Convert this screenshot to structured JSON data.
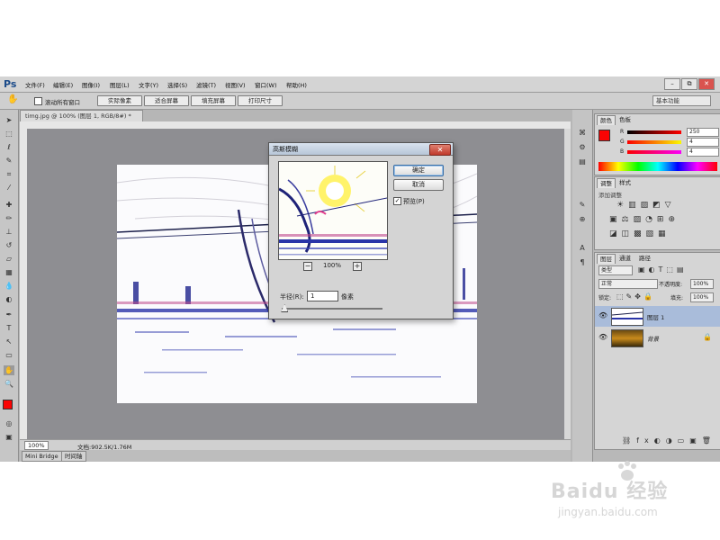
{
  "app": {
    "logo": "Ps",
    "menus": [
      "文件(F)",
      "编辑(E)",
      "图像(I)",
      "图层(L)",
      "文字(Y)",
      "选择(S)",
      "滤镜(T)",
      "视图(V)",
      "窗口(W)",
      "帮助(H)"
    ],
    "window_buttons": [
      "–",
      "⧉",
      "✕"
    ]
  },
  "options_bar": {
    "scroll_all_label": "滚动所有窗口",
    "buttons": [
      "实际像素",
      "适合屏幕",
      "填充屏幕",
      "打印尺寸"
    ],
    "workspace": "基本功能"
  },
  "document": {
    "tab_title": "timg.jpg @ 100% (图层 1, RGB/8#) *",
    "zoom": "100%",
    "doc_info": "文档:902.5K/1.76M"
  },
  "bottom_tabs": [
    "Mini Bridge",
    "时间轴"
  ],
  "color_panel": {
    "tabs": [
      "颜色",
      "色板"
    ],
    "labels": [
      "R",
      "G",
      "B"
    ],
    "values": [
      "250",
      "4",
      "4"
    ],
    "foreground": "#fa0404",
    "background": "#ffffff"
  },
  "adjustments_panel": {
    "tabs": [
      "调整",
      "样式"
    ],
    "hint": "添加调整"
  },
  "layers_panel": {
    "tabs": [
      "图层",
      "通道",
      "路径"
    ],
    "kind_label": "类型",
    "blend_mode": "正常",
    "opacity_label": "不透明度:",
    "opacity_value": "100%",
    "lock_label": "锁定:",
    "fill_label": "填充:",
    "fill_value": "100%",
    "layers": [
      {
        "name": "图层 1",
        "selected": true
      },
      {
        "name": "背景",
        "selected": false,
        "locked": true
      }
    ]
  },
  "dialog": {
    "title": "高斯模糊",
    "ok": "确定",
    "cancel": "取消",
    "preview_label": "预览(P)",
    "preview_checked": true,
    "zoom": "100%",
    "radius_label": "半径(R):",
    "radius_value": "1",
    "unit": "像素",
    "radius_slider_fraction": 0.02
  },
  "watermark": {
    "brand": "Baidu 经验",
    "url": "jingyan.baidu.com"
  }
}
